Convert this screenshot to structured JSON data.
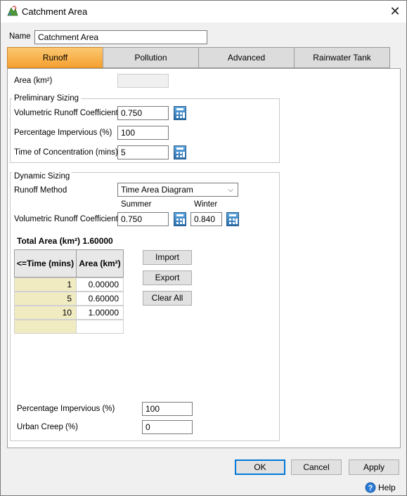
{
  "window": {
    "title": "Catchment Area",
    "close_glyph": "✕"
  },
  "name_label": "Name",
  "name_value": "Catchment Area",
  "tabs": [
    {
      "label": "Runoff",
      "active": true
    },
    {
      "label": "Pollution",
      "active": false
    },
    {
      "label": "Advanced",
      "active": false
    },
    {
      "label": "Rainwater Tank",
      "active": false
    }
  ],
  "area": {
    "label": "Area (km²)",
    "value": ""
  },
  "preliminary": {
    "title": "Preliminary Sizing",
    "vrc_label": "Volumetric Runoff Coefficient",
    "vrc_value": "0.750",
    "pi_label": "Percentage Impervious (%)",
    "pi_value": "100",
    "toc_label": "Time of Concentration (mins)",
    "toc_value": "5"
  },
  "dynamic": {
    "title": "Dynamic Sizing",
    "method_label": "Runoff Method",
    "method_value": "Time Area Diagram",
    "summer_label": "Summer",
    "winter_label": "Winter",
    "vrc_label": "Volumetric Runoff Coefficient",
    "summer_value": "0.750",
    "winter_value": "0.840",
    "total_area_label": "Total Area (km²) 1.60000",
    "table": {
      "headers": [
        "<=Time (mins)",
        "Area (km²)"
      ],
      "rows": [
        {
          "time": "1",
          "area": "0.00000"
        },
        {
          "time": "5",
          "area": "0.60000"
        },
        {
          "time": "10",
          "area": "1.00000"
        },
        {
          "time": "",
          "area": ""
        }
      ]
    },
    "buttons": {
      "import": "Import",
      "export": "Export",
      "clear_all": "Clear All"
    },
    "pi_label": "Percentage Impervious (%)",
    "pi_value": "100",
    "urban_creep_label": "Urban Creep (%)",
    "urban_creep_value": "0"
  },
  "footer": {
    "ok": "OK",
    "cancel": "Cancel",
    "apply": "Apply",
    "help": "Help"
  },
  "icons": {
    "app": "catchment-app-icon",
    "calculator": "calculator-icon",
    "help": "help-icon",
    "close": "close-icon"
  },
  "colors": {
    "active_tab": "#f5a030",
    "grid_row_header": "#f1ebc2",
    "focus": "#0078d7"
  }
}
